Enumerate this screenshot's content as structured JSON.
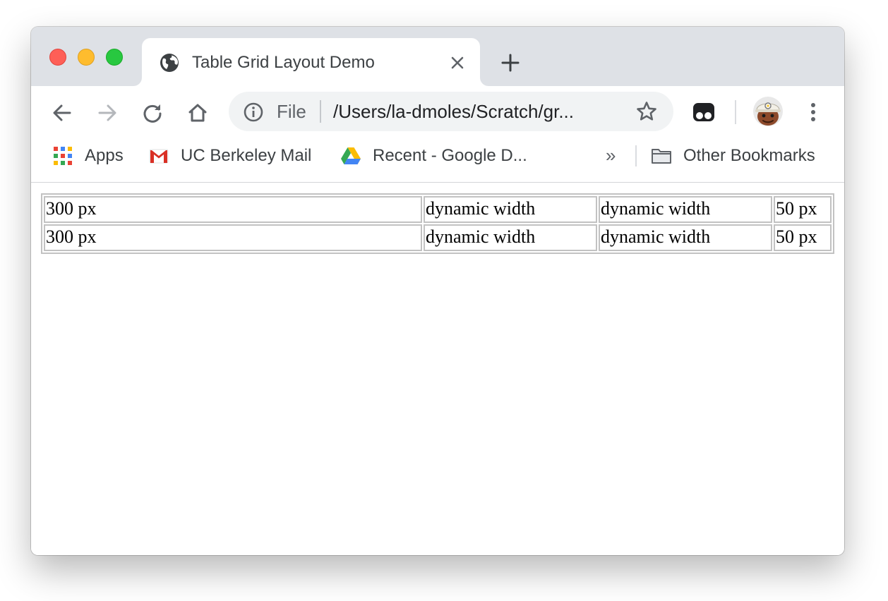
{
  "tab": {
    "title": "Table Grid Layout Demo"
  },
  "omnibox": {
    "scheme_label": "File",
    "url": "/Users/la-dmoles/Scratch/gr..."
  },
  "bookmarks": {
    "items": [
      {
        "label": "Apps",
        "icon": "apps-grid-icon"
      },
      {
        "label": "UC Berkeley Mail",
        "icon": "gmail-icon"
      },
      {
        "label": "Recent - Google D...",
        "icon": "google-drive-icon"
      }
    ],
    "overflow": "»",
    "other": {
      "label": "Other Bookmarks",
      "icon": "folder-icon"
    }
  },
  "table": {
    "rows": [
      [
        "300 px",
        "dynamic width",
        "dynamic width",
        "50 px"
      ],
      [
        "300 px",
        "dynamic width",
        "dynamic width",
        "50 px"
      ]
    ]
  },
  "colors": {
    "tabstrip": "#dee1e6",
    "omnibox": "#f1f3f4",
    "table_border": "#c2c2c2"
  }
}
